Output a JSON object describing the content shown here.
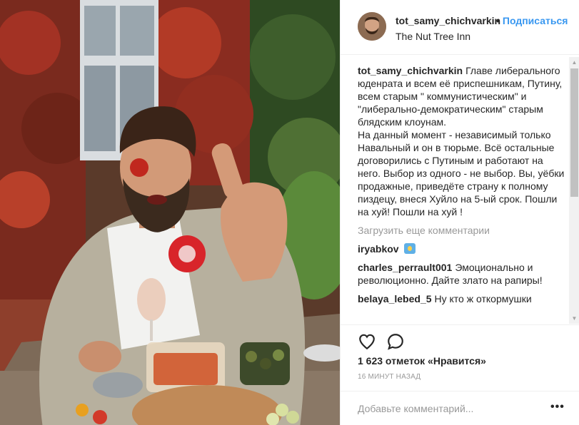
{
  "header": {
    "username": "tot_samy_chichvarkin",
    "separator": "•",
    "follow_label": "Подписаться",
    "location": "The Nut Tree Inn"
  },
  "post": {
    "caption_user": "tot_samy_chichvarkin",
    "caption_text": "Главе либерального юденрата и всем её приспешникам, Путину, всем старым \" коммунистическим\" и \"либерально-демократическим\" старым блядским клоунам.\nНа данный момент - независимый только Навальный и он в тюрьме. Всё остальные договорились с Путиным и работают на него. Выбор из одного - не выбор. Вы, уёбки продажные, приведёте страну к полному пиздецу, внеся Хуйло на 5-ый срок. Пошли на хуй! Пошли на хуй !",
    "load_more": "Загрузить еще комментарии",
    "comments": [
      {
        "user": "iryabkov",
        "text": "",
        "emoji": "waving-hands-emoji"
      },
      {
        "user": "charles_perrault001",
        "text": "Эмоционально и революционно. Дайте злато на рапиры!"
      },
      {
        "user": "belaya_lebed_5",
        "text": "Ну кто ж откормушки"
      }
    ]
  },
  "actions": {
    "like_icon": "heart-icon",
    "comment_icon": "comment-icon",
    "likes_text": "1 623 отметок «Нравится»",
    "time_ago": "16 МИНУТ НАЗАД"
  },
  "add_comment": {
    "placeholder": "Добавьте комментарий...",
    "more_icon": "more-options-icon",
    "more_glyph": "•••"
  },
  "scrollbar": {
    "up_glyph": "▲",
    "down_glyph": "▼"
  }
}
